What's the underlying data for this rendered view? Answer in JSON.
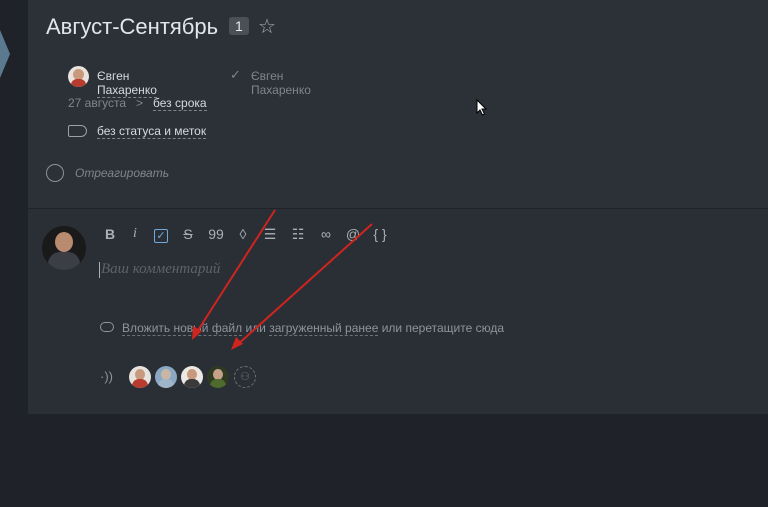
{
  "task": {
    "title": "Август-Сентябрь",
    "count": "1",
    "owner": "Євген Пахаренко",
    "assignee": "Євген Пахаренко",
    "start_date": "27 августа",
    "arrow": ">",
    "deadline": "без срока",
    "status": "без статуса и меток",
    "react": "Отреагировать"
  },
  "editor": {
    "toolbar": [
      "B",
      "i",
      "✓",
      "S",
      "99",
      "◊",
      "☰",
      "☷",
      "∞",
      "@",
      "{ }"
    ],
    "placeholder": "Ваш комментарий",
    "attach_link": "Вложить новый файл",
    "or1": "или",
    "uploaded_link": "загруженный ранее",
    "or2": "или",
    "drag_text": "перетащите сюда",
    "subscribe_icon": "signal-icon"
  },
  "colors": {
    "background": "#1f2329",
    "card": "#2c3138",
    "accent": "#6fa8dc",
    "annotation_arrow": "#d0241f"
  }
}
